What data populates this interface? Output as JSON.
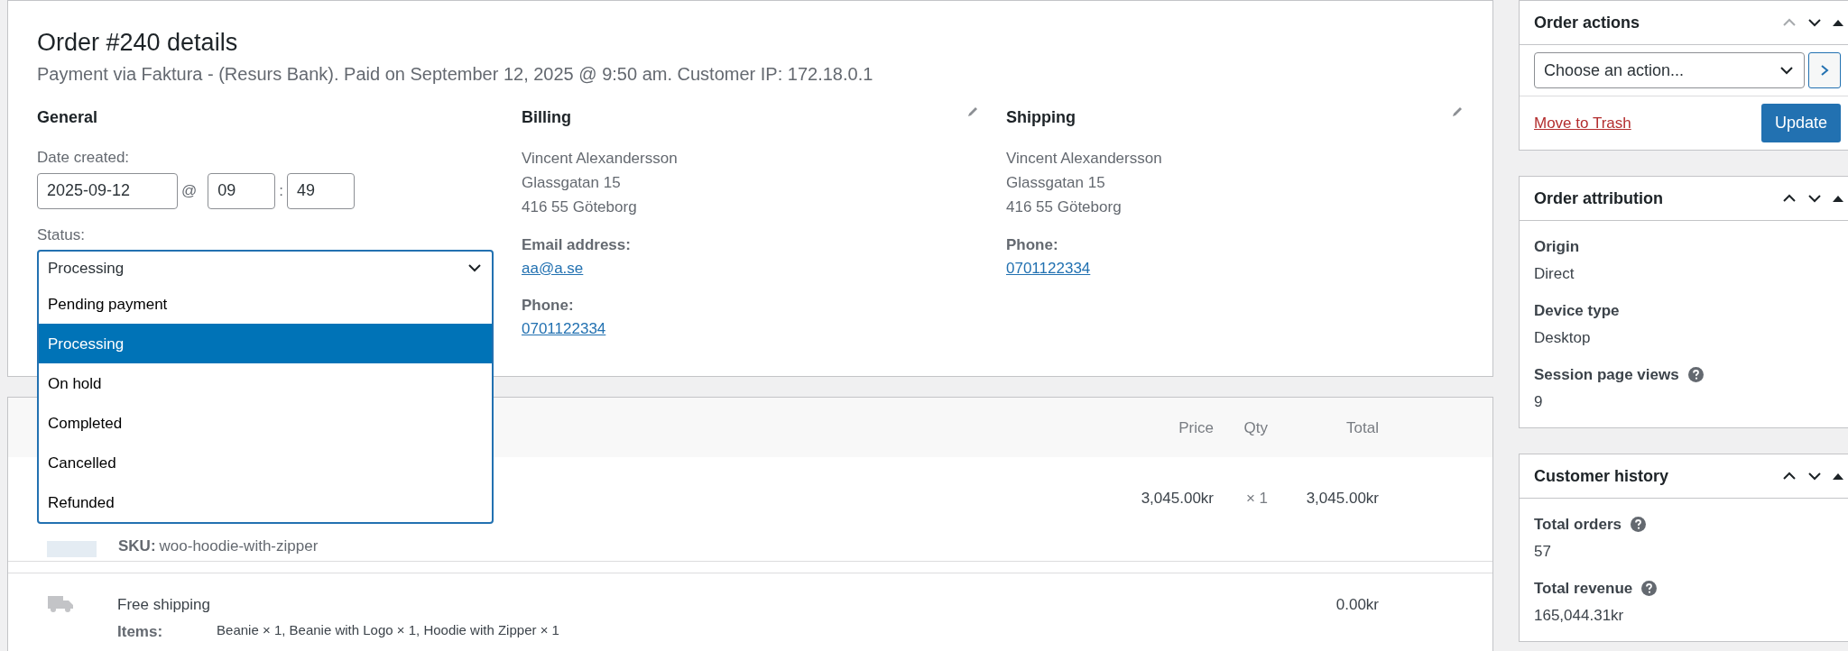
{
  "order": {
    "title": "Order #240 details",
    "subtitle": "Payment via Faktura - (Resurs Bank). Paid on September 12, 2025 @ 9:50 am. Customer IP: 172.18.0.1"
  },
  "general": {
    "heading": "General",
    "date_label": "Date created:",
    "date": "2025-09-12",
    "at": "@",
    "hour": "09",
    "colon": ":",
    "minute": "49",
    "status_label": "Status:",
    "status_value": "Processing",
    "expanded": true,
    "status_options": [
      {
        "label": "Pending payment",
        "selected": false
      },
      {
        "label": "Processing",
        "selected": true
      },
      {
        "label": "On hold",
        "selected": false
      },
      {
        "label": "Completed",
        "selected": false
      },
      {
        "label": "Cancelled",
        "selected": false
      },
      {
        "label": "Refunded",
        "selected": false
      }
    ]
  },
  "addresses": [
    {
      "heading": "Billing",
      "lines": [
        "Vincent Alexandersson",
        "Glassgatan 15",
        "416 55 Göteborg"
      ],
      "fields": [
        {
          "label": "Email address:",
          "value": "aa@a.se"
        },
        {
          "label": "Phone:",
          "value": "0701122334"
        }
      ]
    },
    {
      "heading": "Shipping",
      "lines": [
        "Vincent Alexandersson",
        "Glassgatan 15",
        "416 55 Göteborg"
      ],
      "fields": [
        {
          "label": "Phone:",
          "value": "0701122334"
        }
      ]
    }
  ],
  "items": {
    "columns": [
      "Price",
      "Qty",
      "Total"
    ],
    "rows": [
      {
        "sku_label": "SKU:",
        "sku": "woo-hoodie-with-zipper",
        "price": "3,045.00kr",
        "qty": "× 1",
        "total": "3,045.00kr"
      }
    ],
    "shipping": {
      "name": "Free shipping",
      "items_label": "Items:",
      "items": "Beanie × 1, Beanie with Logo × 1, Hoodie with Zipper × 1",
      "total": "0.00kr"
    }
  },
  "sidebar": [
    {
      "kind": "actions",
      "title": "Order actions",
      "select": "Choose an action...",
      "trash": "Move to Trash",
      "button": "Update"
    },
    {
      "kind": "fields",
      "title": "Order attribution",
      "fields": [
        {
          "label": "Origin",
          "value": "Direct",
          "help": false
        },
        {
          "label": "Device type",
          "value": "Desktop",
          "help": false
        },
        {
          "label": "Session page views",
          "value": "9",
          "help": true
        }
      ]
    },
    {
      "kind": "fields",
      "title": "Customer history",
      "fields": [
        {
          "label": "Total orders",
          "value": "57",
          "help": true
        },
        {
          "label": "Total revenue",
          "value": "165,044.31kr",
          "help": true
        }
      ]
    }
  ]
}
